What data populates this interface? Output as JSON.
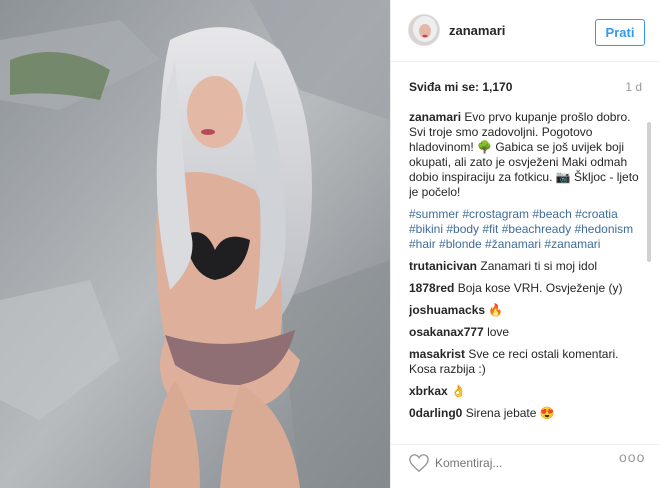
{
  "header": {
    "username": "zanamari",
    "follow_label": "Prati"
  },
  "stats": {
    "likes_text": "Sviđa mi se: 1,170",
    "time_ago": "1 d"
  },
  "comments": [
    {
      "user": "zanamari",
      "text": "Evo prvo kupanje prošlo dobro. Svi troje smo zadovoljni. Pogotovo hladovinom! 🌳 Gabica se još uvijek boji okupati, ali zato je osvježeni Maki odmah dobio inspiraciju za fotkicu. 📷 Škljoc - ljeto je počelo!"
    },
    {
      "hashtags": "#summer #crostagram #beach #croatia #bikini #body #fit #beachready #hedonism #hair #blonde #žanamari #zanamari"
    },
    {
      "user": "trutanicivan",
      "text": "Zanamari ti si moj idol"
    },
    {
      "user": "1878red",
      "text": "Boja kose VRH. Osvježenje (y)"
    },
    {
      "user": "joshuamacks",
      "text": "🔥"
    },
    {
      "user": "osakanax777",
      "text": "love"
    },
    {
      "user": "masakrist",
      "text": "Sve ce reci ostali komentari. Kosa razbija :)"
    },
    {
      "user": "xbrkax",
      "text": "👌"
    },
    {
      "user": "0darling0",
      "text": "Sirena jebate 😍"
    }
  ],
  "footer": {
    "comment_placeholder": "Komentiraj...",
    "more_label": "ooo"
  },
  "icons": {
    "like": "heart-icon",
    "options": "more-options-icon"
  },
  "colors": {
    "accent": "#3897f0",
    "hashtag": "#3e6d9c",
    "muted": "#999999"
  }
}
